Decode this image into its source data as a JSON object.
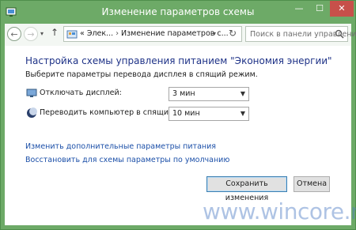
{
  "window": {
    "title": "Изменение параметров схемы",
    "controls": {
      "minimize": "—",
      "maximize": "☐",
      "close": "✕"
    }
  },
  "toolbar": {
    "back_icon": "←",
    "forward_icon": "→",
    "recent_icon": "▾",
    "up_icon": "↑",
    "breadcrumb_prefix": "«",
    "breadcrumb": [
      "Элек...",
      "Изменение параметров с..."
    ],
    "breadcrumb_sep": "›",
    "address_dropdown_icon": "▾",
    "refresh_icon": "↻",
    "search_placeholder": "Поиск в панели управления"
  },
  "content": {
    "heading": "Настройка схемы управления питанием \"Экономия энергии\"",
    "subtext": "Выберите параметры перевода дисплея в спящий режим.",
    "settings": [
      {
        "label": "Отключать дисплей:",
        "value": "3 мин",
        "icon": "display-icon"
      },
      {
        "label": "Переводить компьютер в спящий режим:",
        "value": "10 мин",
        "icon": "moon-icon"
      }
    ],
    "links": [
      "Изменить дополнительные параметры питания",
      "Восстановить для схемы параметры по умолчанию"
    ],
    "buttons": {
      "save": "Сохранить изменения",
      "cancel": "Отмена"
    }
  },
  "watermark": "www.wincore.ru",
  "colors": {
    "frame": "#6daa67",
    "heading": "#1e3287",
    "link": "#1b4fa8",
    "close_button": "#c7504a"
  }
}
